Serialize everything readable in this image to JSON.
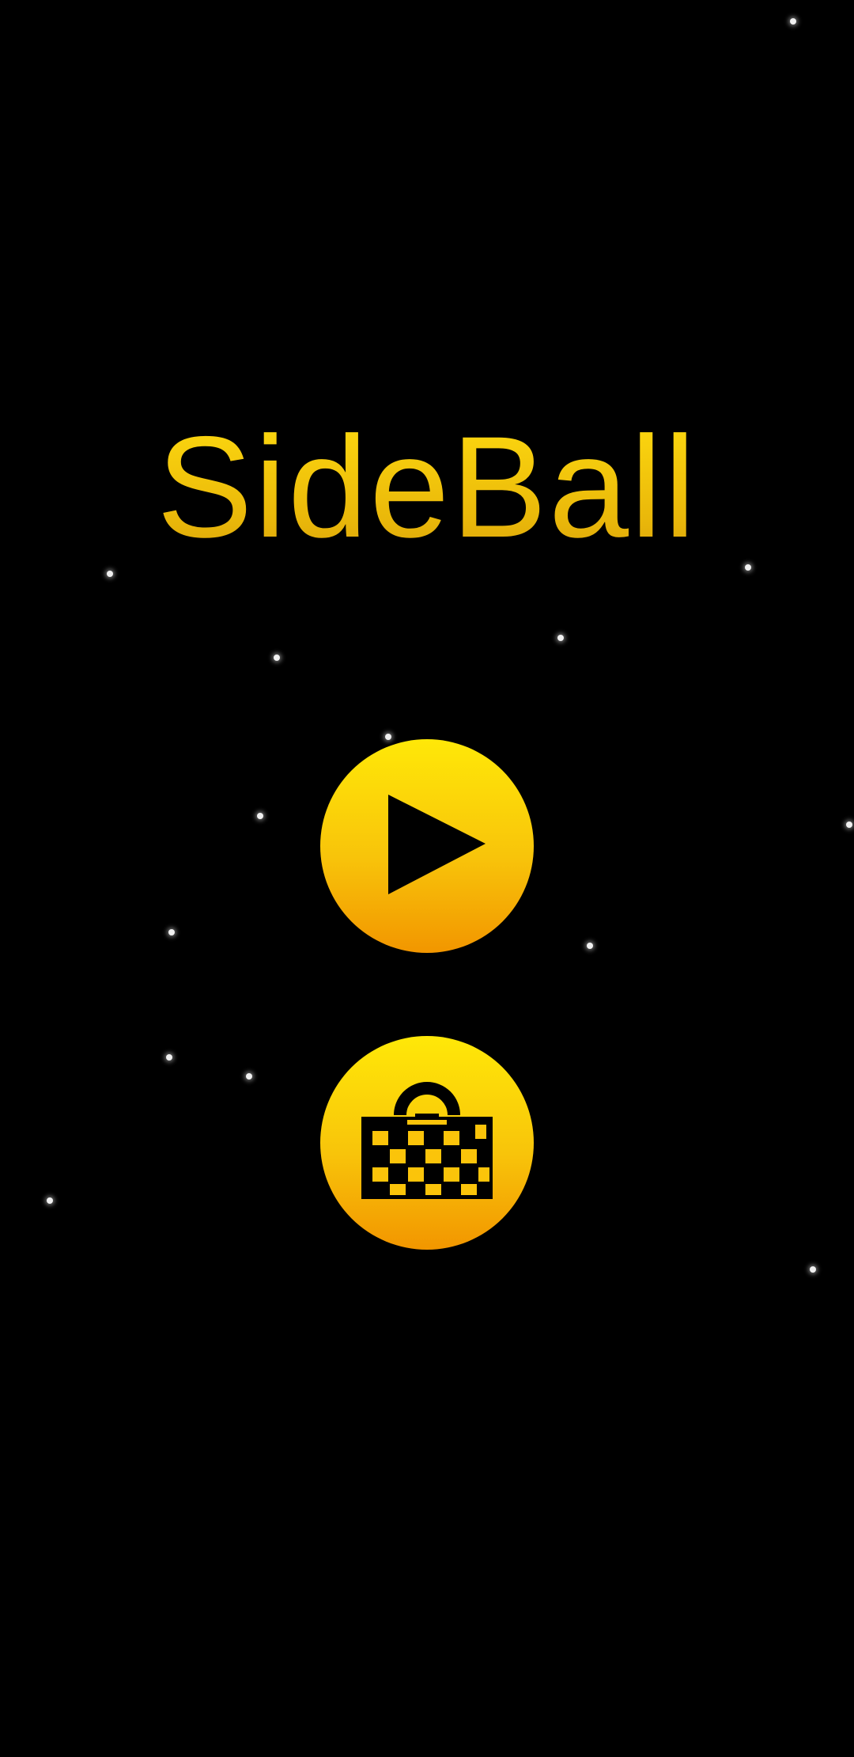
{
  "game": {
    "title": "SideBall"
  },
  "menu": {
    "play_icon": "play-icon",
    "shop_icon": "shop-bag-icon"
  },
  "colors": {
    "background": "#000000",
    "title": "#f5cc0c",
    "button_top": "#ffe808",
    "button_bottom": "#f29600",
    "icon": "#000000",
    "star": "#f0f0f0"
  }
}
